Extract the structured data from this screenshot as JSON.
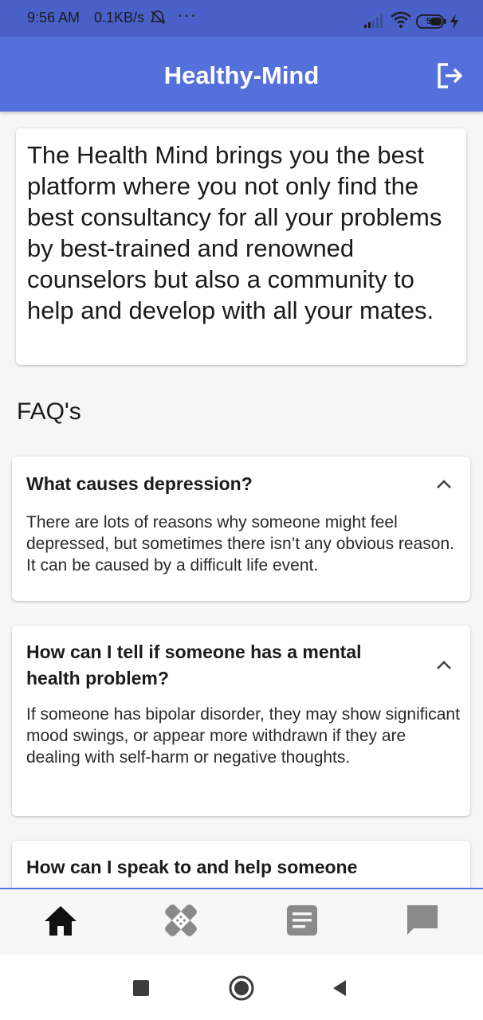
{
  "status_bar": {
    "time": "9:56 AM",
    "speed": "0.1KB/s",
    "more": "···",
    "battery": "58",
    "icons": [
      "alarm-off-icon",
      "signal-icon",
      "wifi-icon",
      "battery-icon",
      "charging-icon"
    ]
  },
  "app_bar": {
    "title": "Healthy-Mind",
    "action_icon": "logout-icon",
    "background": "#5470db"
  },
  "intro": {
    "text": "The Health Mind brings you the best platform where you not only find the best consultancy for all your problems by best-trained and renowned counselors but also a community to help and develop with all your mates."
  },
  "faq": {
    "heading": "FAQ's",
    "items": [
      {
        "question": "What causes depression?",
        "answer": "There are lots of reasons why someone might feel depressed, but sometimes there isn’t any obvious reason. It can be caused by a difficult life event.",
        "expanded": true
      },
      {
        "question": "How can I tell if someone has a mental health problem?",
        "answer": "If someone has bipolar disorder, they may show significant mood swings, or appear more withdrawn if they are dealing with self-harm or negative thoughts.",
        "expanded": true
      },
      {
        "question": "How can I speak to and help someone"
      }
    ]
  },
  "bottom_nav": {
    "items": [
      "home-icon",
      "bandage-icon",
      "notes-icon",
      "chat-icon"
    ],
    "active": "home-icon"
  },
  "system_nav": {
    "items": [
      "recents-icon",
      "home-circle-icon",
      "back-icon"
    ]
  }
}
